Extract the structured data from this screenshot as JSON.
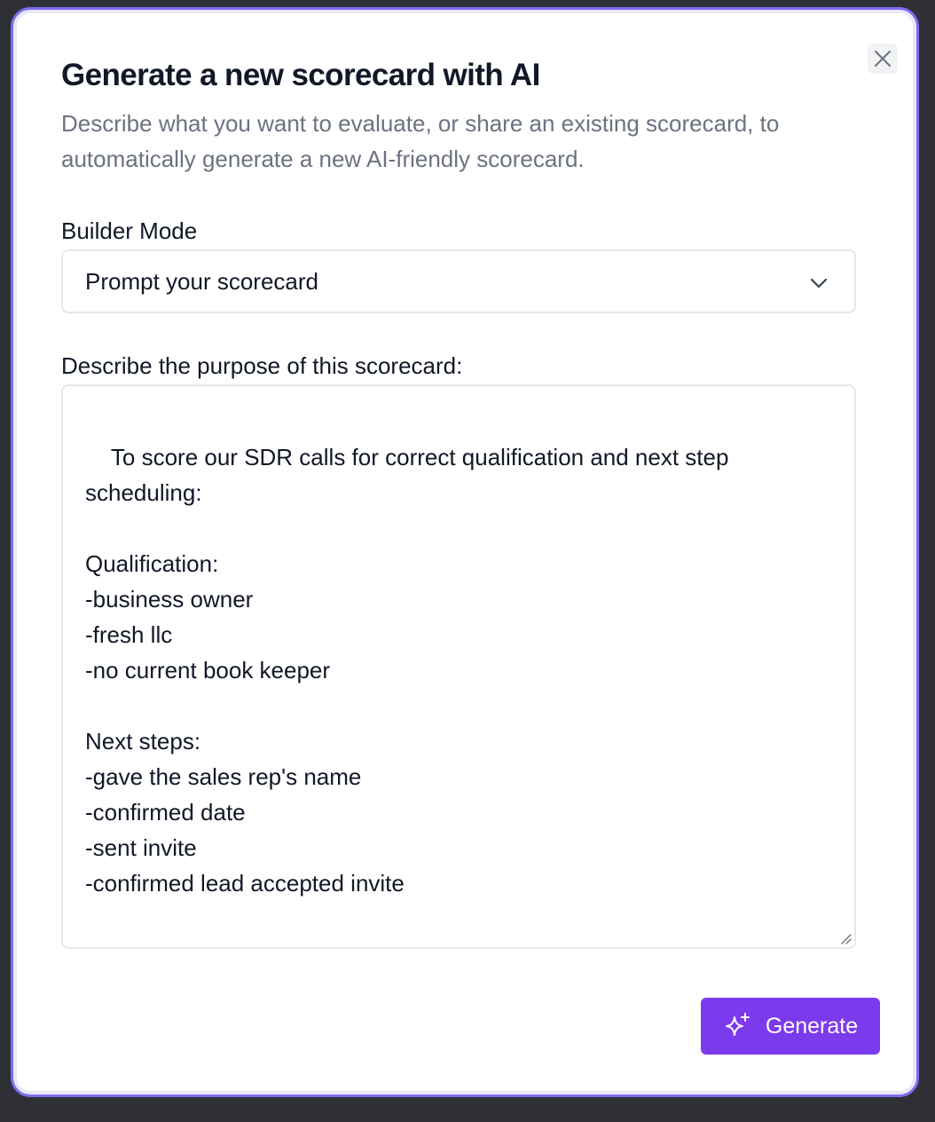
{
  "dialog": {
    "title": "Generate a new scorecard with AI",
    "subtitle": "Describe what you want to evaluate, or share an existing scorecard, to automatically generate a new AI-friendly scorecard.",
    "close_icon": "close-icon"
  },
  "builder_mode": {
    "label": "Builder Mode",
    "selected": "Prompt your scorecard",
    "icon": "chevron-down-icon"
  },
  "purpose": {
    "label": "Describe the purpose of this scorecard:",
    "value": "To score our SDR calls for correct qualification and next step scheduling:\n\nQualification:\n-business owner\n-fresh llc\n-no current book keeper\n\nNext steps:\n-gave the sales rep's name\n-confirmed date\n-sent invite\n-confirmed lead accepted invite"
  },
  "actions": {
    "generate_label": "Generate",
    "generate_icon": "sparkles-icon"
  },
  "colors": {
    "accent": "#7c3aed",
    "modal_border": "#7c6cf0",
    "text_primary": "#111827",
    "text_muted": "#6b7280"
  }
}
